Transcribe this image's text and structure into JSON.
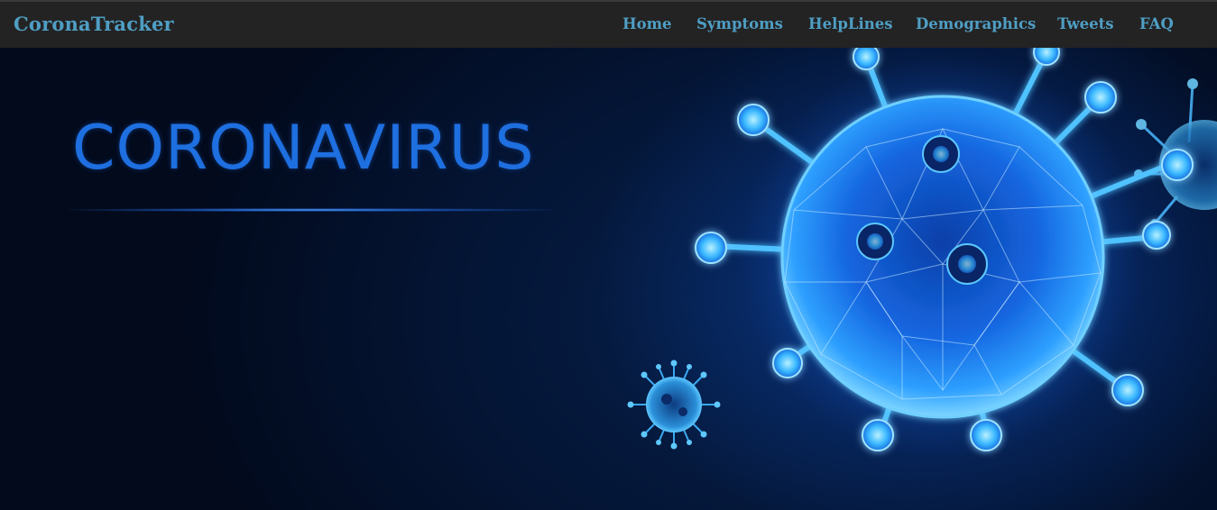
{
  "navbar": {
    "brand": "CoronaTracker",
    "links": [
      "Home",
      "Symptoms",
      "HelpLines",
      "Demographics",
      "Tweets",
      "FAQ"
    ]
  },
  "hero": {
    "title": "CORONAVIRUS"
  },
  "colors": {
    "navbar_bg": "#232323",
    "nav_text": "#4f9ec4",
    "hero_bg": "#03112a",
    "title_blue": "#1e6fe0",
    "virus_glow": "#3ab8ff"
  },
  "icons": [
    "large-virus-illustration",
    "small-virus-illustration",
    "partial-virus-illustration"
  ]
}
